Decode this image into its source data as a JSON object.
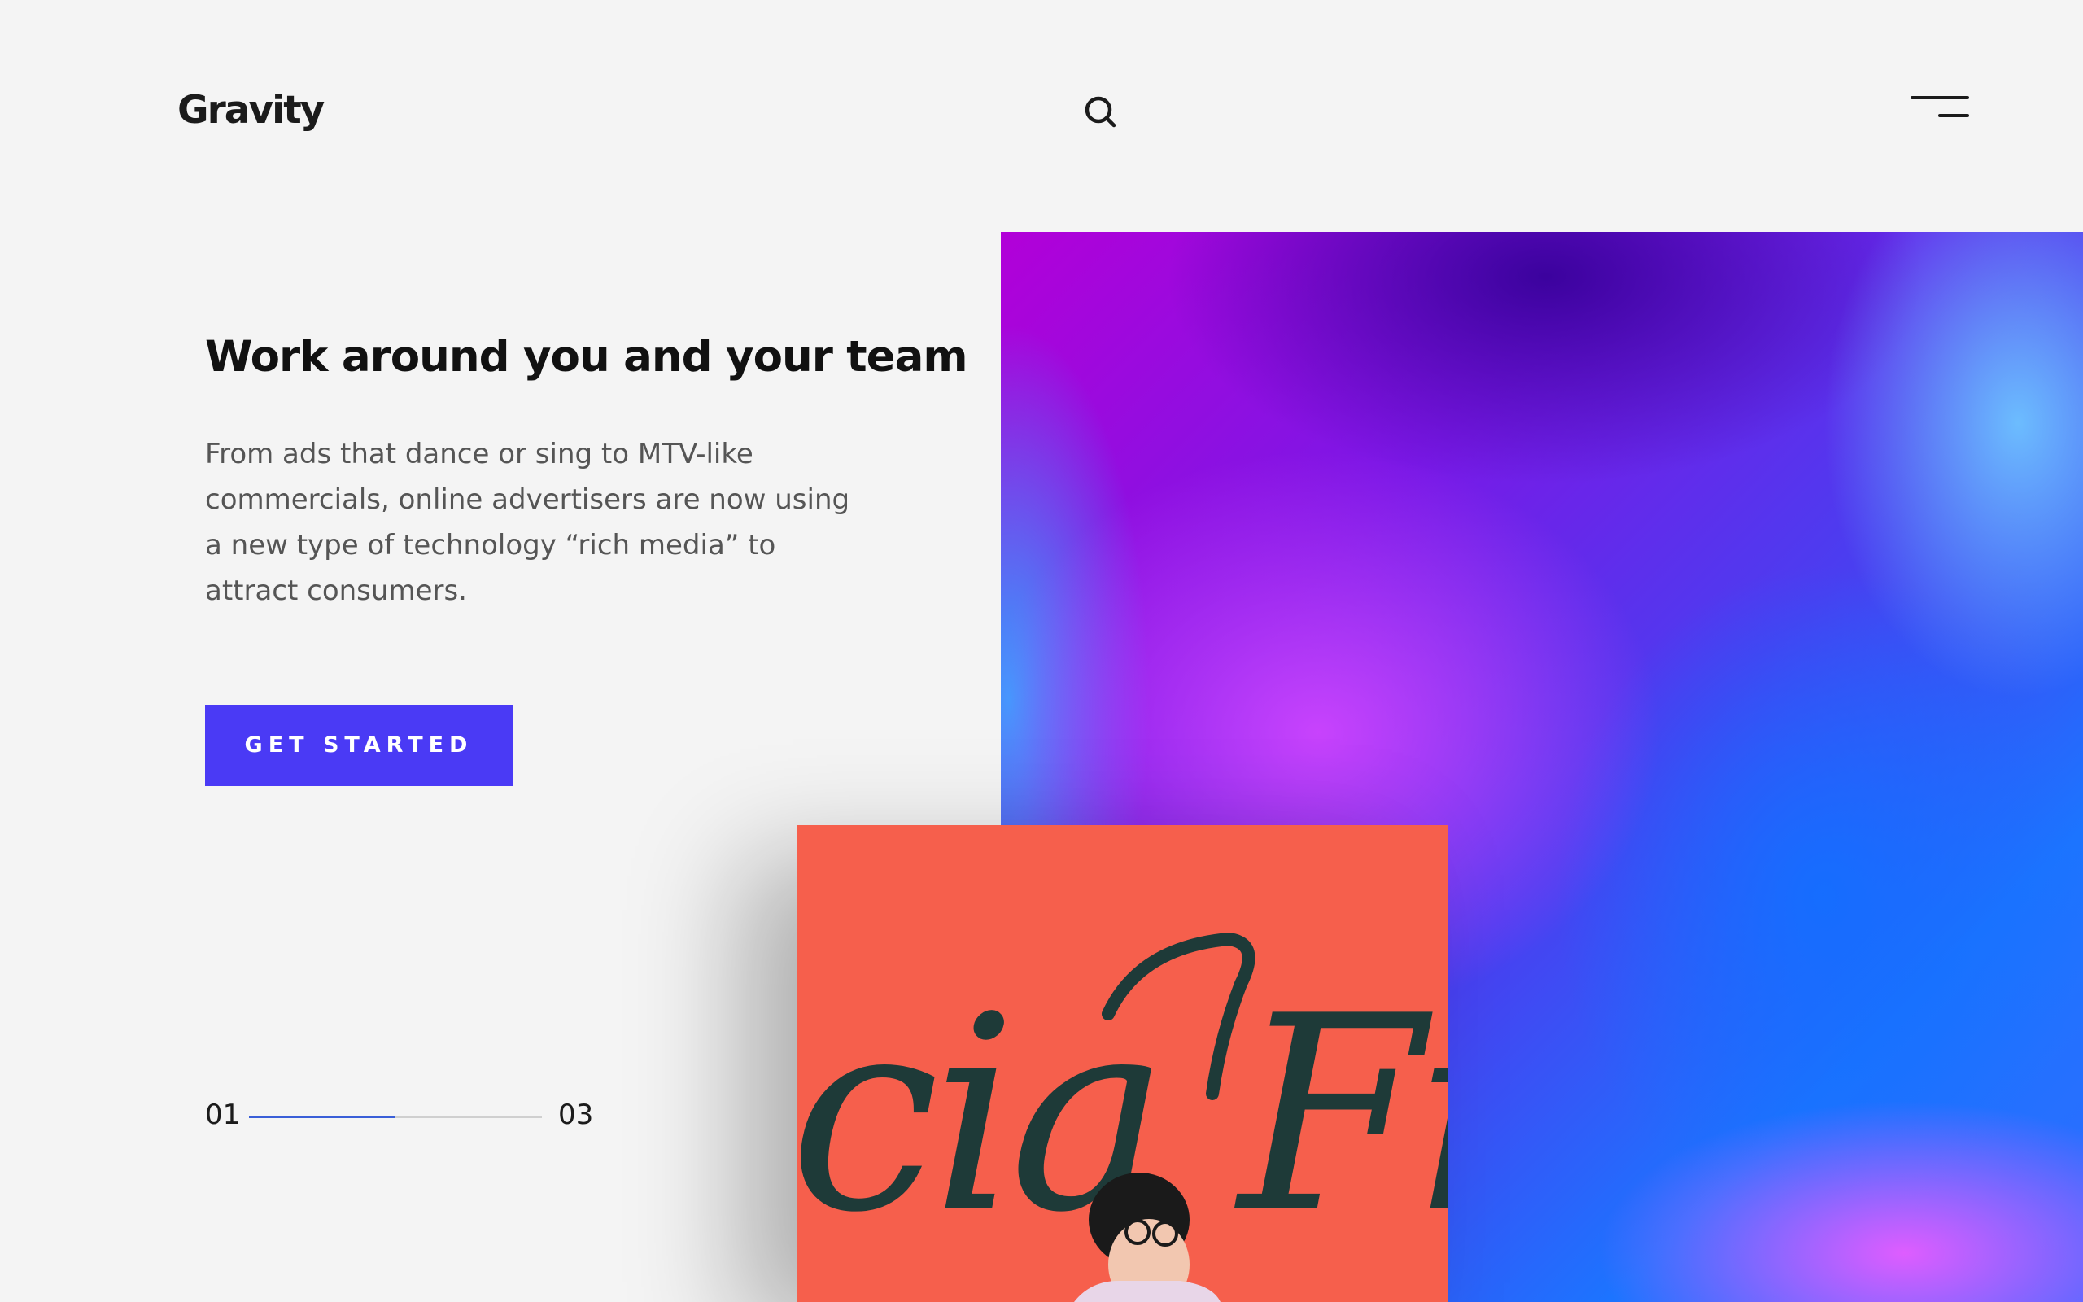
{
  "brand": {
    "name": "Gravity"
  },
  "header": {
    "search_icon": "search-icon",
    "menu_icon": "hamburger-menu-icon"
  },
  "hero": {
    "title": "Work around you and your team",
    "description": "From ads that dance or sing to MTV-like commercials, online advertisers are now using a new type of technology “rich media” to attract consumers.",
    "cta_label": "GET STARTED"
  },
  "slider": {
    "current": "01",
    "total": "03",
    "progress": 0.5
  },
  "colors": {
    "accent": "#4a3af5",
    "background": "#f4f4f4",
    "progress": "#3a5fd8"
  },
  "photo": {
    "wall_text": "cia Fie"
  }
}
